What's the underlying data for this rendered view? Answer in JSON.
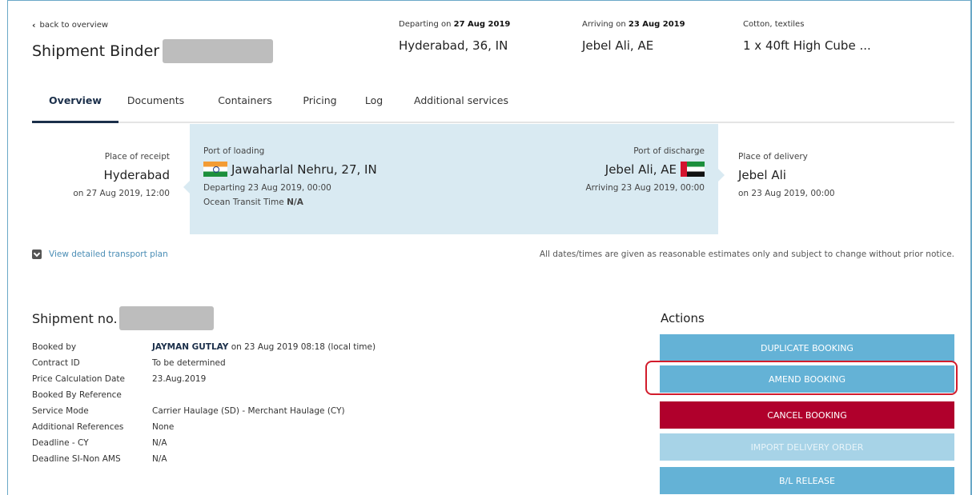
{
  "header": {
    "back_label": "back to overview",
    "title": "Shipment Binder",
    "departing": {
      "label": "Departing on",
      "date": "27 Aug 2019",
      "value": "Hyderabad, 36, IN"
    },
    "arriving": {
      "label": "Arriving on",
      "date": "23 Aug 2019",
      "value": "Jebel Ali, AE"
    },
    "cargo": {
      "label": "Cotton, textiles",
      "value": "1 x 40ft High Cube ..."
    }
  },
  "tabs": [
    {
      "label": "Overview",
      "active": true
    },
    {
      "label": "Documents"
    },
    {
      "label": "Containers"
    },
    {
      "label": "Pricing"
    },
    {
      "label": "Log"
    },
    {
      "label": "Additional services"
    }
  ],
  "route": {
    "receipt": {
      "label": "Place of receipt",
      "place": "Hyderabad",
      "date": "on 27 Aug 2019, 12:00"
    },
    "loading": {
      "label": "Port of loading",
      "place": "Jawaharlal Nehru, 27, IN",
      "departing": "Departing 23 Aug 2019, 00:00",
      "transit_label": "Ocean Transit Time",
      "transit_value": "N/A"
    },
    "discharge": {
      "label": "Port of discharge",
      "place": "Jebel Ali, AE",
      "arriving": "Arriving 23 Aug 2019, 00:00"
    },
    "delivery": {
      "label": "Place of delivery",
      "place": "Jebel Ali",
      "date": "on 23 Aug 2019, 00:00"
    }
  },
  "view_plan": "View detailed transport plan",
  "disclaimer": "All dates/times are given as reasonable estimates only and subject to change without prior notice.",
  "shipment": {
    "title": "Shipment no.",
    "rows": [
      {
        "label": "Booked by",
        "value_bold": "JAYMAN GUTLAY",
        "value": " on 23 Aug 2019 08:18 (local time)"
      },
      {
        "label": "Contract ID",
        "value": "To be determined"
      },
      {
        "label": "Price Calculation Date",
        "value": "23.Aug.2019"
      },
      {
        "label": "Booked By Reference",
        "value": ""
      },
      {
        "label": "Service Mode",
        "value": "Carrier Haulage (SD) - Merchant Haulage (CY)"
      },
      {
        "label": "Additional References",
        "value": "None"
      },
      {
        "label": "Deadline - CY",
        "value": "N/A"
      },
      {
        "label": "Deadline SI-Non AMS",
        "value": "N/A"
      }
    ]
  },
  "actions": {
    "title": "Actions",
    "duplicate": "DUPLICATE BOOKING",
    "amend": "AMEND BOOKING",
    "cancel": "CANCEL BOOKING",
    "import_delivery": "IMPORT DELIVERY ORDER",
    "bl_release": "B/L RELEASE"
  },
  "colors": {
    "accent": "#64b2d6",
    "danger": "#b0002c",
    "highlight": "#d21c2c"
  }
}
